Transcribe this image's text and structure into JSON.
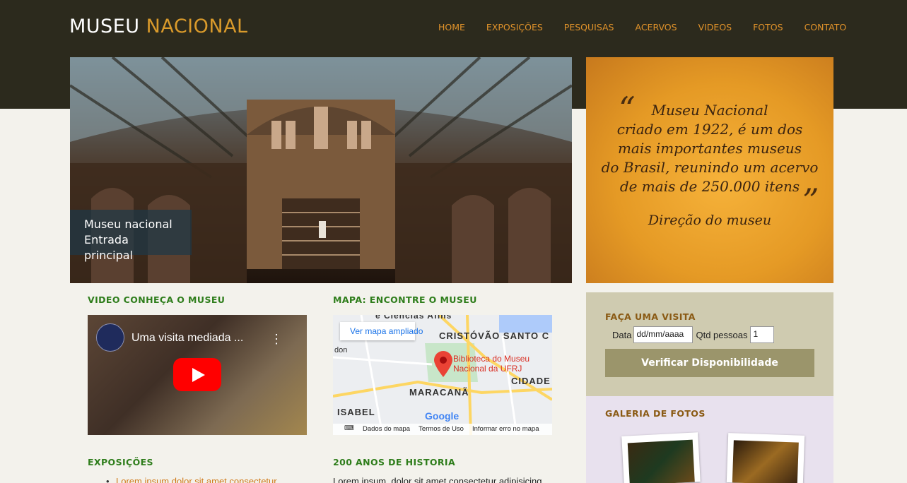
{
  "header": {
    "logo_part1": "MUSEU",
    "logo_part2": "NACIONAL",
    "nav": [
      "HOME",
      "EXPOSIÇÕES",
      "PESQUISAS",
      "ACERVOS",
      "VIDEOS",
      "FOTOS",
      "CONTATO"
    ]
  },
  "hero": {
    "caption_line1": "Museu nacional",
    "caption_line2": "Entrada principal"
  },
  "quote": {
    "open_mark": "“",
    "close_mark": "”",
    "lines": [
      "Museu Nacional",
      "criado em 1922, é um dos",
      "mais importantes museus",
      "do Brasil, reunindo um acervo",
      "de mais de 250.000 itens"
    ],
    "author": "Direção do museu"
  },
  "video_section": {
    "title": "VIDEO CONHEÇA O MUSEU",
    "video_title": "Uma visita mediada ..."
  },
  "map_section": {
    "title": "MAPA: ENCONTRE O MUSEU",
    "button": "Ver mapa ampliado",
    "labels": [
      "e Ciências Afins",
      "CRISTÓVÃO SANTO C",
      "CIDADE",
      "MARACANÃ",
      "ISABEL",
      "don"
    ],
    "place_line1": "Biblioteca do Museu",
    "place_line2": "Nacional da UFRJ",
    "google": "Google",
    "footer": [
      "Dados do mapa",
      "Termos de Uso",
      "Informar erro no mapa"
    ]
  },
  "visit": {
    "title": "FAÇA UMA VISITA",
    "date_label": "Data",
    "date_placeholder": "dd/mm/aaaa",
    "qty_label": "Qtd pessoas",
    "qty_value": "1",
    "button": "Verificar Disponibilidade"
  },
  "gallery": {
    "title": "GALERIA DE FOTOS"
  },
  "exposicoes": {
    "title": "EXPOSIÇÕES",
    "item": "Lorem ipsum dolor sit amet consectetur"
  },
  "historia": {
    "title": "200 ANOS DE HISTORIA",
    "text": "Lorem ipsum, dolor sit amet consectetur adipisicing"
  }
}
